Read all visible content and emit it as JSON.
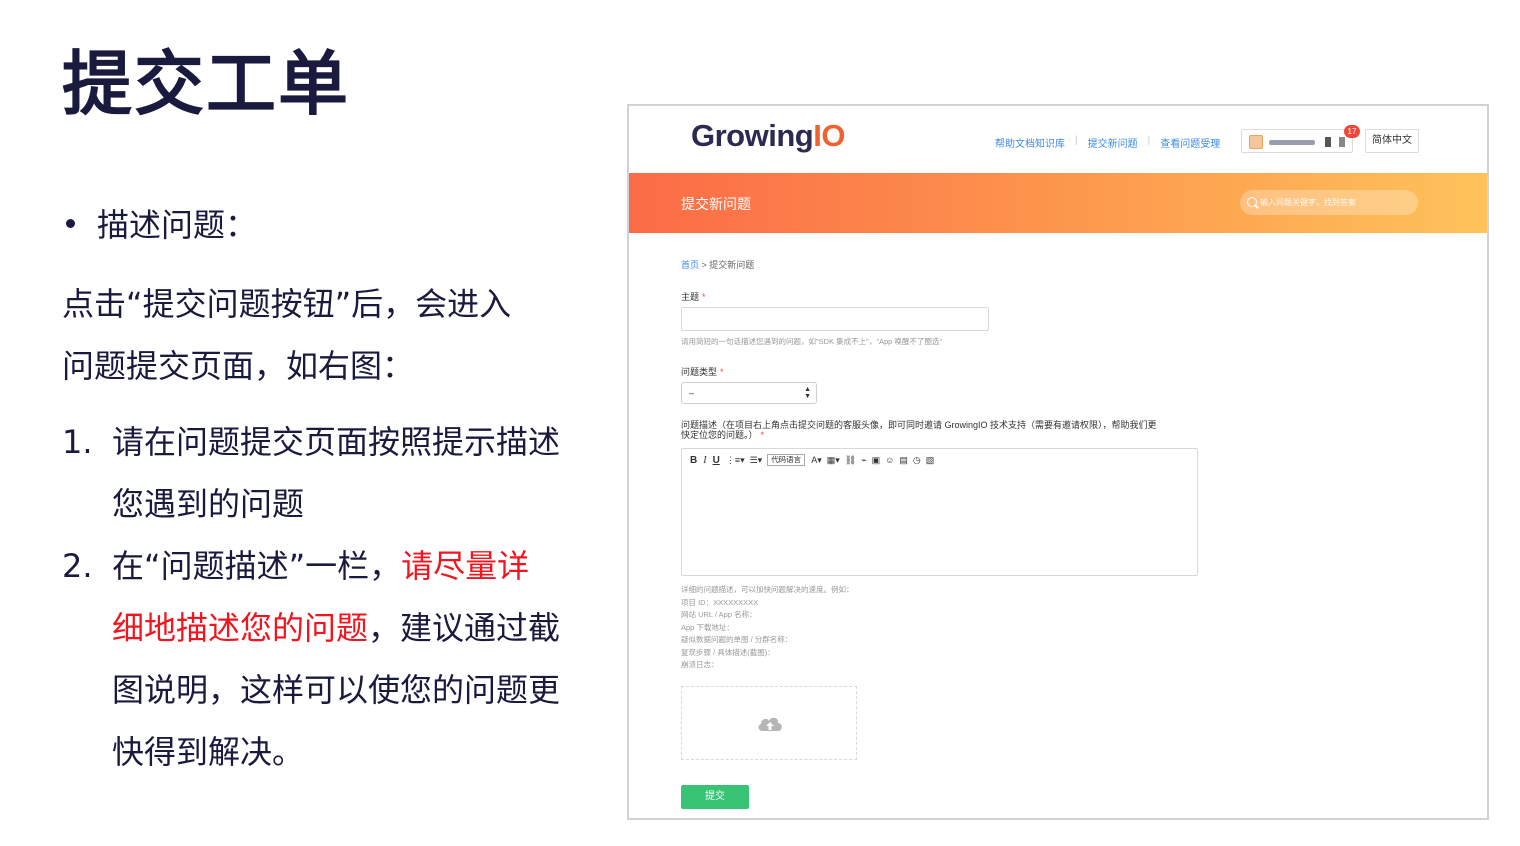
{
  "slide": {
    "title": "提交工单",
    "bullet": "描述问题：",
    "intro_line1": "点击“提交问题按钮”后，会进入",
    "intro_line2": "问题提交页面，如右图：",
    "steps": [
      {
        "num": "1.",
        "line1": "请在问题提交页面按照提示描述",
        "line2": "您遇到的问题"
      },
      {
        "num": "2.",
        "line1_pre": "在“问题描述”一栏，",
        "line1_red": "请尽量详",
        "line2_red": "细地描述您的问题",
        "line2_post": "，建议通过截",
        "line3": "图说明，这样可以使您的问题更",
        "line4": "快得到解决。"
      }
    ],
    "colors": {
      "title": "#1a1a3e",
      "emphasis": "#f2141e"
    }
  },
  "app": {
    "logo_main": "Growing",
    "logo_accent": "IO",
    "nav": [
      "帮助文档知识库",
      "提交新问题",
      "查看问题受理"
    ],
    "notification_count": "17",
    "language": "简体中文",
    "banner_title": "提交新问题",
    "search_placeholder": "输入问题关键字，找到答案",
    "breadcrumb_home": "首页",
    "breadcrumb_sep": " > ",
    "breadcrumb_current": "提交新问题",
    "subject_label": "主题",
    "required_mark": "*",
    "subject_hint": "请用简短的一句话描述您遇到的问题，如\"SDK 集成不上\"，\"App 唤醒不了圈选\"",
    "type_label": "问题类型",
    "type_value": "–",
    "desc_label_line1": "问题描述（在项目右上角点击提交问题的客服头像，即可同时邀请 GrowingIO 技术支持（需要有邀请权限），帮助我们更",
    "desc_label_line2": "快定位您的问题。）",
    "toolbar": {
      "bold": "B",
      "italic": "I",
      "underline": "U",
      "code_lang": "代码语言",
      "font_color": "A"
    },
    "desc_hints": [
      "详细的问题描述，可以加快问题解决的速度。例如：",
      "项目 ID：XXXXXXXXX",
      "网站 URL / App 名称：",
      "App 下载地址：",
      "疑似数据问题的单图 / 分群名称：",
      "复现步骤 / 具体描述(截图)：",
      "崩溃日志："
    ],
    "submit_label": "提交",
    "colors": {
      "banner_start": "#fc6b47",
      "banner_end": "#fec35b",
      "link": "#3d8ae6",
      "submit": "#38c474",
      "required": "#f0473c"
    }
  }
}
